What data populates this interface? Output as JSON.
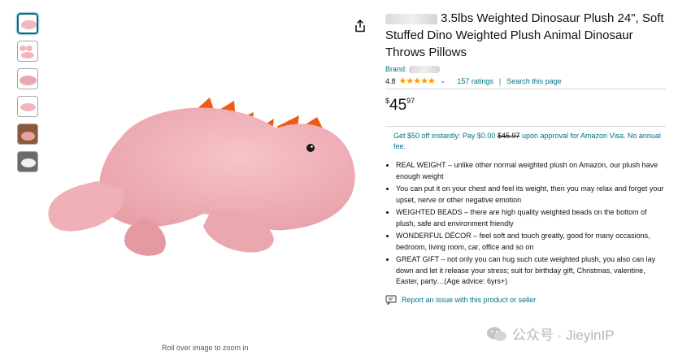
{
  "thumbnails": [
    {
      "name": "thumb-1"
    },
    {
      "name": "thumb-2"
    },
    {
      "name": "thumb-3"
    },
    {
      "name": "thumb-4"
    },
    {
      "name": "thumb-5"
    },
    {
      "name": "thumb-6"
    }
  ],
  "zoom_hint": "Roll over image to zoom in",
  "product": {
    "title_visible": "3.5lbs Weighted Dinosaur Plush 24\", Soft Stuffed Dino Weighted Plush Animal Dinosaur Throws Pillows",
    "brand_label": "Brand:",
    "rating": "4.8",
    "ratings_count": "157 ratings",
    "search_link": "Search this page",
    "price_symbol": "$",
    "price_whole": "45",
    "price_fraction": "97"
  },
  "promo": {
    "text_before": "Get $50 off instantly: Pay $0.00",
    "strike_price": "$45.97",
    "text_after": "upon approval for Amazon Visa. No annual fee."
  },
  "bullets": [
    "REAL WEIGHT – unlike other normal weighted plush on Amazon, our plush have enough weight",
    "You can put it on your chest and feel its weight, then you may relax and forget your upset, nerve or other negative emotion",
    "WEIGHTED BEADS – there are high quality weighted beads on the bottom of plush, safe and environment friendly",
    "WONDERFUL DÉCOR – feel soft and touch greatly, good for many occasions, bedroom, living room, car, office and so on",
    "GREAT GIFT – not only you can hug such cute weighted plush, you also can lay down and let it release your stress; suit for birthday gift, Christmas, valentine, Easter, party…(Age advice: 6yrs+)"
  ],
  "report_link": "Report an issue with this product or seller",
  "watermark": "公众号 · JieyinIP",
  "colors": {
    "link": "#007185",
    "star": "#ff9900",
    "plush": "#f2b6bd",
    "spikes": "#f05a16"
  }
}
